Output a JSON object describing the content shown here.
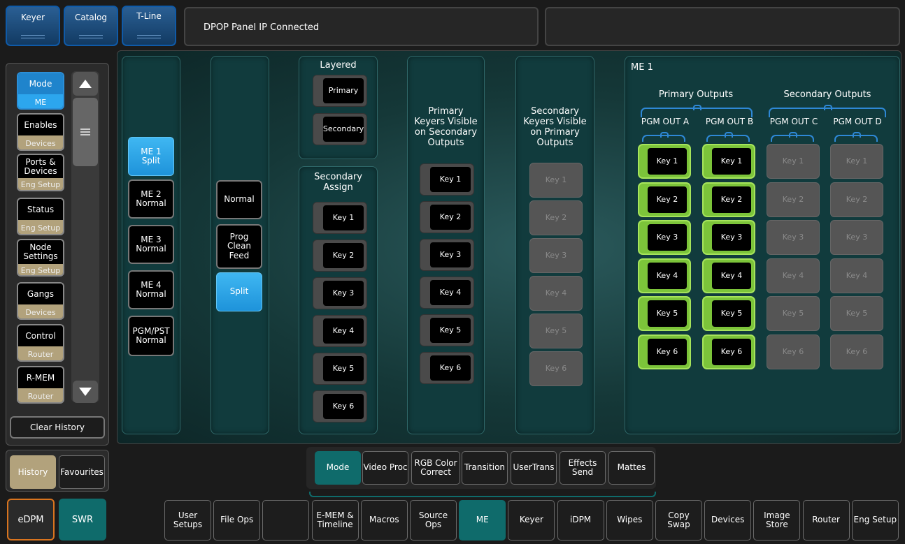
{
  "top_tabs": [
    "Keyer",
    "Catalog",
    "T-Line"
  ],
  "status_message": "DPOP Panel IP Connected",
  "sidebar": {
    "items": [
      {
        "label": "Mode",
        "sub": "ME"
      },
      {
        "label": "Enables",
        "sub": "Devices"
      },
      {
        "label": "Ports & Devices",
        "sub": "Eng Setup"
      },
      {
        "label": "Status",
        "sub": "Eng Setup"
      },
      {
        "label": "Node Settings",
        "sub": "Eng Setup"
      },
      {
        "label": "Gangs",
        "sub": "Devices"
      },
      {
        "label": "Control",
        "sub": "Router"
      },
      {
        "label": "R-MEM",
        "sub": "Router"
      }
    ],
    "clear_history": "Clear History",
    "history": "History",
    "favourites": "Favourites"
  },
  "me_list": [
    {
      "line1": "ME 1",
      "line2": "Split",
      "selected": true
    },
    {
      "line1": "ME 2",
      "line2": "Normal",
      "selected": false
    },
    {
      "line1": "ME 3",
      "line2": "Normal",
      "selected": false
    },
    {
      "line1": "ME 4",
      "line2": "Normal",
      "selected": false
    },
    {
      "line1": "PGM/PST",
      "line2": "Normal",
      "selected": false
    }
  ],
  "mode_options": [
    {
      "label": "Normal",
      "selected": false
    },
    {
      "label": "Prog Clean Feed",
      "selected": false
    },
    {
      "label": "Split",
      "selected": true
    }
  ],
  "layered": {
    "title": "Layered",
    "buttons": [
      "Primary",
      "Secondary"
    ]
  },
  "secondary_assign": {
    "title": "Secondary Assign",
    "keys": [
      "Key 1",
      "Key 2",
      "Key 3",
      "Key 4",
      "Key 5",
      "Key 6"
    ]
  },
  "primary_on_secondary": {
    "title": "Primary Keyers Visible on Secondary Outputs",
    "keys": [
      "Key 1",
      "Key 2",
      "Key 3",
      "Key 4",
      "Key 5",
      "Key 6"
    ]
  },
  "secondary_on_primary": {
    "title": "Secondary Keyers Visible on Primary Outputs",
    "keys": [
      "Key 1",
      "Key 2",
      "Key 3",
      "Key 4",
      "Key 5",
      "Key 6"
    ]
  },
  "me_outputs": {
    "title": "ME 1",
    "primary_label": "Primary Outputs",
    "secondary_label": "Secondary Outputs",
    "columns": [
      {
        "name": "PGM OUT A",
        "active": true
      },
      {
        "name": "PGM OUT B",
        "active": true
      },
      {
        "name": "PGM OUT C",
        "active": false
      },
      {
        "name": "PGM OUT D",
        "active": false
      }
    ],
    "keys": [
      "Key 1",
      "Key 2",
      "Key 3",
      "Key 4",
      "Key 5",
      "Key 6"
    ]
  },
  "page_tabs": [
    {
      "label": "Mode",
      "selected": true
    },
    {
      "label": "Video Proc",
      "selected": false
    },
    {
      "label": "RGB Color Correct",
      "selected": false
    },
    {
      "label": "Transition",
      "selected": false
    },
    {
      "label": "UserTrans",
      "selected": false
    },
    {
      "label": "Effects Send",
      "selected": false
    },
    {
      "label": "Mattes",
      "selected": false
    }
  ],
  "bottom_left": [
    "eDPM",
    "SWR"
  ],
  "bottom_tabs": [
    {
      "label": "User Setups",
      "selected": false
    },
    {
      "label": "File Ops",
      "selected": false
    },
    {
      "label": "",
      "selected": false
    },
    {
      "label": "E-MEM & Timeline",
      "selected": false
    },
    {
      "label": "Macros",
      "selected": false
    },
    {
      "label": "Source Ops",
      "selected": false
    },
    {
      "label": "ME",
      "selected": true
    },
    {
      "label": "Keyer",
      "selected": false
    },
    {
      "label": "iDPM",
      "selected": false
    },
    {
      "label": "Wipes",
      "selected": false
    },
    {
      "label": "Copy Swap",
      "selected": false
    },
    {
      "label": "Devices",
      "selected": false
    },
    {
      "label": "Image Store",
      "selected": false
    },
    {
      "label": "Router",
      "selected": false
    },
    {
      "label": "Eng Setup",
      "selected": false
    }
  ],
  "colors": {
    "accent_blue": "#1e93da",
    "teal": "#0f6b6b",
    "active_green": "#7cc43a",
    "tan": "#b2a27c"
  }
}
